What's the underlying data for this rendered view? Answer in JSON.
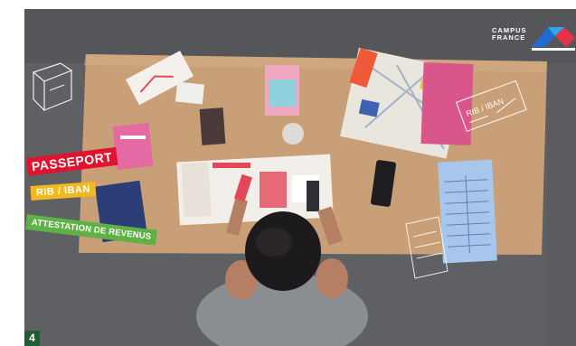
{
  "logo": {
    "line1": "CAMPUS",
    "line2": "FRANCE"
  },
  "labels": {
    "passeport": "PASSEPORT",
    "rib_iban": "RIB / IBAN",
    "attestation": "ATTESTATION DE REVENUS"
  },
  "sketch_labels": {
    "rib_iban": "RIB / IBAN"
  },
  "step_number": "4",
  "colors": {
    "passeport": "#e3132f",
    "rib_iban": "#f2b91e",
    "attestation": "#5fb046",
    "badge": "#1f5e30",
    "table": "#caa27a",
    "floor": "#5e5f62"
  }
}
